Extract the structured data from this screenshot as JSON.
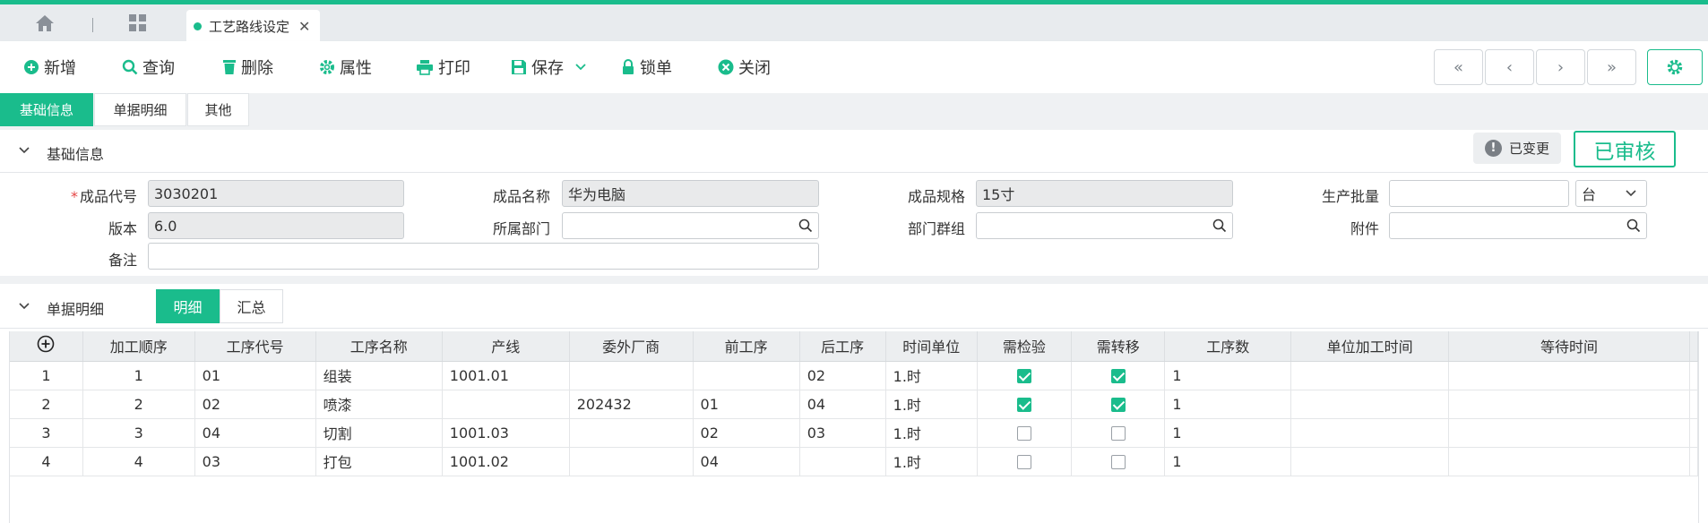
{
  "tabs": {
    "doc_tab": "工艺路线设定"
  },
  "toolbar": {
    "add": "新增",
    "query": "查询",
    "delete": "删除",
    "properties": "属性",
    "print": "打印",
    "save": "保存",
    "lock": "锁单",
    "close": "关闭"
  },
  "section_tabs": [
    "基础信息",
    "单据明细",
    "其他"
  ],
  "basic": {
    "title": "基础信息",
    "changed": "已变更",
    "approved": "已审核",
    "fields": {
      "product_code_label": "成品代号",
      "product_code": "3030201",
      "product_name_label": "成品名称",
      "product_name": "华为电脑",
      "product_spec_label": "成品规格",
      "product_spec": "15寸",
      "batch_label": "生产批量",
      "batch": "",
      "unit": "台",
      "version_label": "版本",
      "version": "6.0",
      "dept_label": "所属部门",
      "dept": "",
      "dept_group_label": "部门群组",
      "dept_group": "",
      "attach_label": "附件",
      "attach": "",
      "remark_label": "备注",
      "remark": ""
    }
  },
  "detail": {
    "title": "单据明细",
    "seg_detail": "明细",
    "seg_summary": "汇总",
    "columns": [
      "加工顺序",
      "工序代号",
      "工序名称",
      "产线",
      "委外厂商",
      "前工序",
      "后工序",
      "时间单位",
      "需检验",
      "需转移",
      "工序数",
      "单位加工时间",
      "等待时间"
    ],
    "rows": [
      {
        "idx": "1",
        "seq": "1",
        "code": "01",
        "name": "组装",
        "line": "1001.01",
        "vendor": "",
        "prev": "",
        "next": "02",
        "time_unit": "1.时",
        "inspect": true,
        "transfer": true,
        "count": "1",
        "unit_time": "",
        "wait": ""
      },
      {
        "idx": "2",
        "seq": "2",
        "code": "02",
        "name": "喷漆",
        "line": "",
        "vendor": "202432",
        "prev": "01",
        "next": "04",
        "time_unit": "1.时",
        "inspect": true,
        "transfer": true,
        "count": "1",
        "unit_time": "",
        "wait": ""
      },
      {
        "idx": "3",
        "seq": "3",
        "code": "04",
        "name": "切割",
        "line": "1001.03",
        "vendor": "",
        "prev": "02",
        "next": "03",
        "time_unit": "1.时",
        "inspect": false,
        "transfer": false,
        "count": "1",
        "unit_time": "",
        "wait": ""
      },
      {
        "idx": "4",
        "seq": "4",
        "code": "03",
        "name": "打包",
        "line": "1001.02",
        "vendor": "",
        "prev": "04",
        "next": "",
        "time_unit": "1.时",
        "inspect": false,
        "transfer": false,
        "count": "1",
        "unit_time": "",
        "wait": ""
      }
    ]
  },
  "colors": {
    "accent": "#1abc8c",
    "required": "#e54545"
  }
}
